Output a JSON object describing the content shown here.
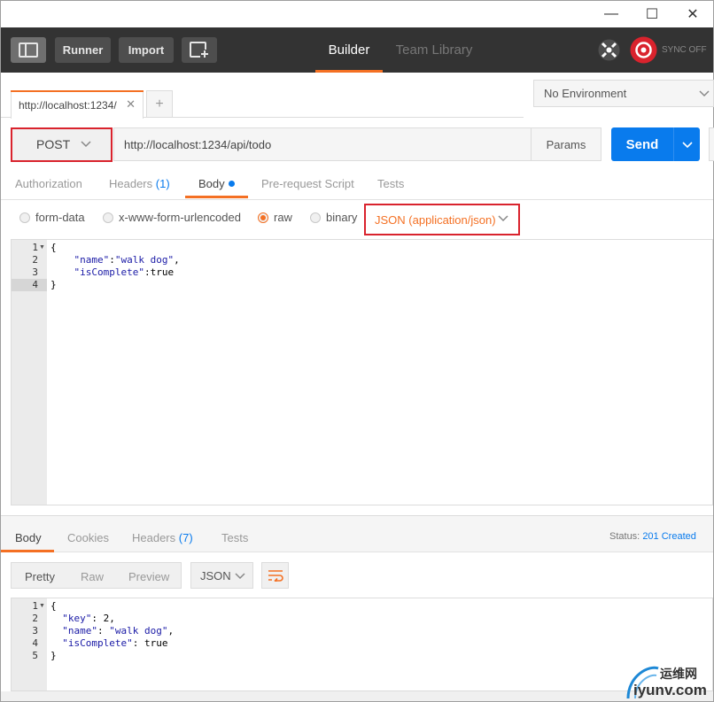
{
  "window": {
    "minimize": "—",
    "maximize": "☐",
    "close": "✕"
  },
  "header": {
    "runner": "Runner",
    "import": "Import",
    "tab_builder": "Builder",
    "tab_team_library": "Team Library",
    "sync": "SYNC OFF",
    "accent": "#f47023"
  },
  "tabs": {
    "request_tab": "http://localhost:1234/",
    "add": "+",
    "close": "✕"
  },
  "environment": {
    "selected": "No Environment"
  },
  "request": {
    "method": "POST",
    "url": "http://localhost:1234/api/todo",
    "params": "Params",
    "send": "Send"
  },
  "subtabs": {
    "authorization": "Authorization",
    "headers": "Headers",
    "headers_count": "(1)",
    "body": "Body",
    "prerequest": "Pre-request Script",
    "tests": "Tests"
  },
  "body_types": {
    "form_data": "form-data",
    "urlencoded": "x-www-form-urlencoded",
    "raw": "raw",
    "binary": "binary",
    "content_type": "JSON (application/json)"
  },
  "request_body": {
    "lines": [
      {
        "n": "1",
        "fold": true,
        "parts": [
          {
            "t": "{",
            "c": "plain"
          }
        ]
      },
      {
        "n": "2",
        "fold": false,
        "parts": [
          {
            "t": "    \"name\"",
            "c": "key"
          },
          {
            "t": ":",
            "c": "plain"
          },
          {
            "t": "\"walk dog\"",
            "c": "str"
          },
          {
            "t": ",",
            "c": "plain"
          }
        ]
      },
      {
        "n": "3",
        "fold": false,
        "parts": [
          {
            "t": "    \"isComplete\"",
            "c": "key"
          },
          {
            "t": ":true",
            "c": "plain"
          }
        ]
      },
      {
        "n": "4",
        "fold": false,
        "parts": [
          {
            "t": "}",
            "c": "plain"
          }
        ]
      }
    ]
  },
  "response": {
    "tab_body": "Body",
    "tab_cookies": "Cookies",
    "tab_headers": "Headers",
    "headers_count": "(7)",
    "tab_tests": "Tests",
    "status_label": "Status:",
    "status_value": "201 Created",
    "view_pretty": "Pretty",
    "view_raw": "Raw",
    "view_preview": "Preview",
    "format": "JSON",
    "lines": [
      {
        "n": "1",
        "fold": true,
        "parts": [
          {
            "t": "{",
            "c": "plain"
          }
        ]
      },
      {
        "n": "2",
        "fold": false,
        "parts": [
          {
            "t": "  \"key\"",
            "c": "key"
          },
          {
            "t": ": 2,",
            "c": "plain"
          }
        ]
      },
      {
        "n": "3",
        "fold": false,
        "parts": [
          {
            "t": "  \"name\"",
            "c": "key"
          },
          {
            "t": ": ",
            "c": "plain"
          },
          {
            "t": "\"walk dog\"",
            "c": "str"
          },
          {
            "t": ",",
            "c": "plain"
          }
        ]
      },
      {
        "n": "4",
        "fold": false,
        "parts": [
          {
            "t": "  \"isComplete\"",
            "c": "key"
          },
          {
            "t": ": true",
            "c": "plain"
          }
        ]
      },
      {
        "n": "5",
        "fold": false,
        "parts": [
          {
            "t": "}",
            "c": "plain"
          }
        ]
      }
    ]
  },
  "watermark": {
    "line1": "运维网",
    "line2": "iyunv.com"
  }
}
